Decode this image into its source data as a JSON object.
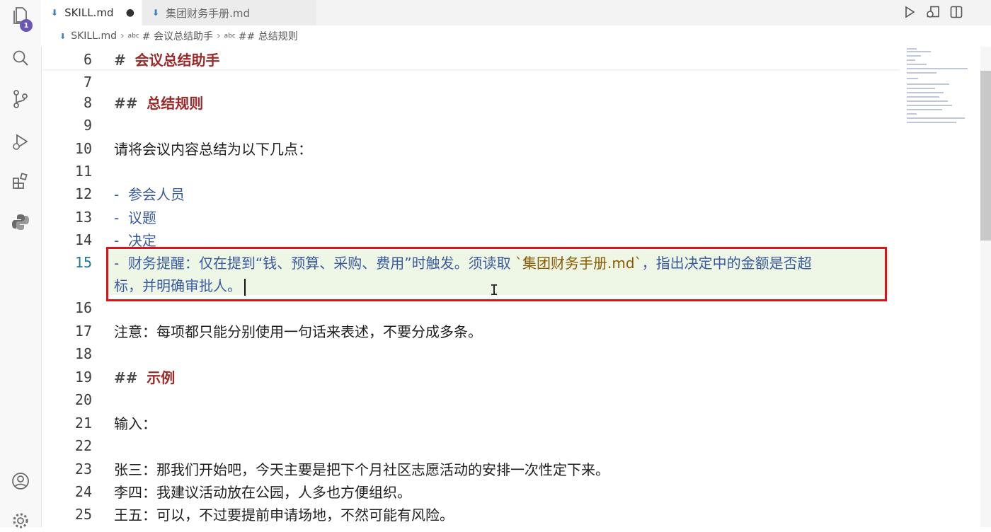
{
  "activity_bar": {
    "explorer_badge": "1"
  },
  "tabs": [
    {
      "label": "SKILL.md",
      "modified": "●"
    },
    {
      "label": "集团财务手册.md"
    }
  ],
  "breadcrumb": {
    "file": "SKILL.md",
    "abc1": "abc",
    "section": "# 会议总结助手",
    "abc2": "abc",
    "subsection": "## 总结规则"
  },
  "editor": {
    "current_line": "15",
    "lines": {
      "l6": {
        "num": "6",
        "hash": "#",
        "heading": "会议总结助手"
      },
      "l7": {
        "num": "7"
      },
      "l8": {
        "num": "8",
        "hash": "##",
        "heading": "总结规则"
      },
      "l9": {
        "num": "9"
      },
      "l10": {
        "num": "10",
        "text": "请将会议内容总结为以下几点："
      },
      "l11": {
        "num": "11"
      },
      "l12": {
        "num": "12",
        "dash": "-",
        "text": "参会人员"
      },
      "l13": {
        "num": "13",
        "dash": "-",
        "text": "议题"
      },
      "l14": {
        "num": "14",
        "dash": "-",
        "text": "决定"
      },
      "l15": {
        "num": "15",
        "dash": "-",
        "text_a": "财务提醒：仅在提到“钱、预算、采购、费用”时触发。须读取 ",
        "code": "`集团财务手册.md`",
        "text_b": "，指出决定中的金额是否超",
        "text_c": "标，并明确审批人。"
      },
      "l16": {
        "num": "16"
      },
      "l17": {
        "num": "17",
        "text": "注意：每项都只能分别使用一句话来表述，不要分成多条。"
      },
      "l18": {
        "num": "18"
      },
      "l19": {
        "num": "19",
        "hash": "##",
        "heading": "示例"
      },
      "l20": {
        "num": "20"
      },
      "l21": {
        "num": "21",
        "text": "输入："
      },
      "l22": {
        "num": "22"
      },
      "l23": {
        "num": "23",
        "text": "张三：那我们开始吧，今天主要是把下个月社区志愿活动的安排一次性定下来。"
      },
      "l24": {
        "num": "24",
        "text": "李四：我建议活动放在公园，人多也方便组织。"
      },
      "l25": {
        "num": "25",
        "text": "王五：可以，不过要提前申请场地，不然可能有风险。"
      }
    }
  },
  "colors": {
    "heading": "#9b2a2a",
    "list_item": "#3a5aa0",
    "inline_code": "#8a5a00",
    "highlight_box": "#e0101a",
    "current_line_bg": "#eef7e6",
    "badge": "#6c55b8"
  }
}
